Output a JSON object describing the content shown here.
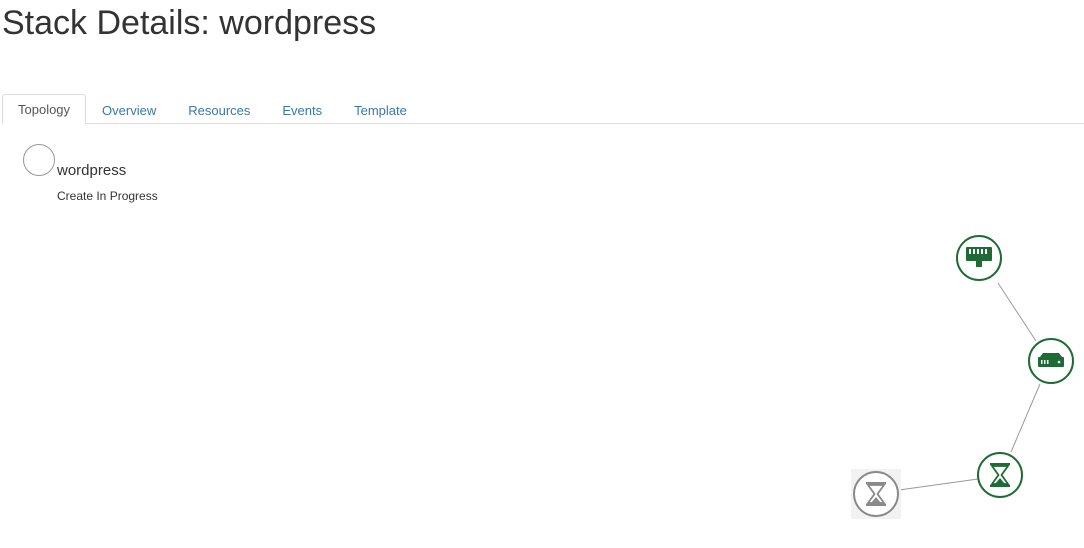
{
  "header": {
    "title": "Stack Details: wordpress"
  },
  "tabs": [
    {
      "label": "Topology",
      "active": true
    },
    {
      "label": "Overview",
      "active": false
    },
    {
      "label": "Resources",
      "active": false
    },
    {
      "label": "Events",
      "active": false
    },
    {
      "label": "Template",
      "active": false
    }
  ],
  "stack": {
    "name": "wordpress",
    "status": "Create In Progress"
  },
  "topology": {
    "nodes": [
      {
        "id": "network",
        "icon": "network-icon",
        "state": "complete"
      },
      {
        "id": "router",
        "icon": "router-icon",
        "state": "complete"
      },
      {
        "id": "in-progress-resource",
        "icon": "hourglass-icon",
        "state": "in-progress"
      },
      {
        "id": "pending-resource",
        "icon": "hourglass-icon",
        "state": "pending"
      }
    ],
    "links": [
      [
        "network",
        "router"
      ],
      [
        "router",
        "in-progress-resource"
      ],
      [
        "in-progress-resource",
        "pending-resource"
      ]
    ]
  },
  "colors": {
    "complete": "#1f6b35",
    "pending": "#8a8a8a",
    "link": "#9a9a9a",
    "tab_link": "#3b78a8"
  }
}
